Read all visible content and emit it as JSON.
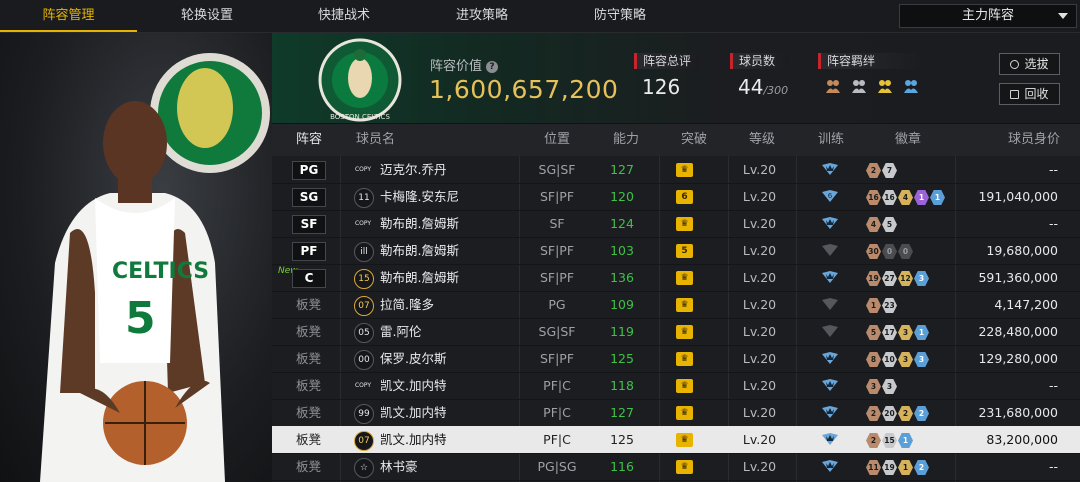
{
  "nav": {
    "tabs": [
      {
        "label": "阵容管理",
        "active": true
      },
      {
        "label": "轮换设置",
        "active": false
      },
      {
        "label": "快捷战术",
        "active": false
      },
      {
        "label": "进攻策略",
        "active": false
      },
      {
        "label": "防守策略",
        "active": false
      }
    ],
    "lineup_select": "主力阵容"
  },
  "header": {
    "team_logo_text": "BOSTON CELTICS",
    "value_label": "阵容价值",
    "value": "1,600,657,200",
    "overall_label": "阵容总评",
    "overall": "126",
    "players_label": "球员数",
    "players": "44",
    "players_max": "/300",
    "chem_label": "阵容羁绊",
    "draft_btn": "选拔",
    "recycle_btn": "回收"
  },
  "columns": {
    "lineup": "阵容",
    "name": "球员名",
    "position": "位置",
    "ability": "能力",
    "breakthrough": "突破",
    "level": "等级",
    "training": "训练",
    "badges": "徽章",
    "salary": "球员身价"
  },
  "colors": {
    "accent": "#e6b400",
    "ability_green": "#3fc047",
    "selected_row": "#e9e9e9"
  },
  "rows": [
    {
      "slot": "PG",
      "new": "",
      "jersey": "COPY",
      "name": "迈克尔.乔丹",
      "pos": "SG|SF",
      "ovr": "127",
      "brk": "♛",
      "lv": "Lv.20",
      "train": "on",
      "badges": [
        [
          "bronze",
          "2"
        ],
        [
          "silver",
          "7"
        ]
      ],
      "salary": "--"
    },
    {
      "slot": "SG",
      "new": "",
      "jersey": "11",
      "name": "卡梅隆.安东尼",
      "pos": "SF|PF",
      "ovr": "120",
      "brk": "6",
      "lv": "Lv.20",
      "train": "6",
      "badges": [
        [
          "bronze",
          "16"
        ],
        [
          "silver",
          "16"
        ],
        [
          "gold",
          "4"
        ],
        [
          "purple",
          "1"
        ],
        [
          "blue",
          "1"
        ]
      ],
      "salary": "191,040,000"
    },
    {
      "slot": "SF",
      "new": "",
      "jersey": "COPY",
      "name": "勒布朗.詹姆斯",
      "pos": "SF",
      "ovr": "124",
      "brk": "♛",
      "lv": "Lv.20",
      "train": "on",
      "badges": [
        [
          "bronze",
          "4"
        ],
        [
          "silver",
          "5"
        ]
      ],
      "salary": "--"
    },
    {
      "slot": "PF",
      "new": "",
      "jersey": "ill",
      "name": "勒布朗.詹姆斯",
      "pos": "SF|PF",
      "ovr": "103",
      "brk": "5",
      "lv": "Lv.20",
      "train": "off",
      "badges": [
        [
          "bronze",
          "30"
        ],
        [
          "dark",
          "0"
        ],
        [
          "dark",
          "0"
        ]
      ],
      "salary": "19,680,000"
    },
    {
      "slot": "C",
      "new": "New",
      "jersey": "15",
      "name": "勒布朗.詹姆斯",
      "pos": "SF|PF",
      "ovr": "136",
      "brk": "♛",
      "lv": "Lv.20",
      "train": "on",
      "badges": [
        [
          "bronze",
          "19"
        ],
        [
          "silver",
          "27"
        ],
        [
          "gold",
          "12"
        ],
        [
          "blue",
          "3"
        ]
      ],
      "salary": "591,360,000"
    },
    {
      "slot": "板凳",
      "new": "",
      "jersey": "07",
      "name": "拉简.隆多",
      "pos": "PG",
      "ovr": "109",
      "brk": "♛",
      "lv": "Lv.20",
      "train": "off",
      "badges": [
        [
          "bronze",
          "1"
        ],
        [
          "silver",
          "23"
        ]
      ],
      "salary": "4,147,200"
    },
    {
      "slot": "板凳",
      "new": "",
      "jersey": "05",
      "name": "雷.阿伦",
      "pos": "SG|SF",
      "ovr": "119",
      "brk": "♛",
      "lv": "Lv.20",
      "train": "off",
      "badges": [
        [
          "bronze",
          "5"
        ],
        [
          "silver",
          "17"
        ],
        [
          "gold",
          "3"
        ],
        [
          "blue",
          "1"
        ]
      ],
      "salary": "228,480,000"
    },
    {
      "slot": "板凳",
      "new": "",
      "jersey": "00",
      "name": "保罗.皮尔斯",
      "pos": "SF|PF",
      "ovr": "125",
      "brk": "♛",
      "lv": "Lv.20",
      "train": "on",
      "badges": [
        [
          "bronze",
          "8"
        ],
        [
          "silver",
          "10"
        ],
        [
          "gold",
          "3"
        ],
        [
          "blue",
          "3"
        ]
      ],
      "salary": "129,280,000"
    },
    {
      "slot": "板凳",
      "new": "",
      "jersey": "COPY",
      "name": "凯文.加内特",
      "pos": "PF|C",
      "ovr": "118",
      "brk": "♛",
      "lv": "Lv.20",
      "train": "on",
      "badges": [
        [
          "bronze",
          "3"
        ],
        [
          "silver",
          "3"
        ]
      ],
      "salary": "--"
    },
    {
      "slot": "板凳",
      "new": "",
      "jersey": "99",
      "name": "凯文.加内特",
      "pos": "PF|C",
      "ovr": "127",
      "brk": "♛",
      "lv": "Lv.20",
      "train": "on",
      "badges": [
        [
          "bronze",
          "2"
        ],
        [
          "silver",
          "20"
        ],
        [
          "gold",
          "2"
        ],
        [
          "blue",
          "2"
        ]
      ],
      "salary": "231,680,000"
    },
    {
      "slot": "板凳",
      "new": "",
      "jersey": "07",
      "name": "凯文.加内特",
      "pos": "PF|C",
      "ovr": "125",
      "brk": "♛",
      "lv": "Lv.20",
      "train": "on",
      "badges": [
        [
          "bronze",
          "2"
        ],
        [
          "silver",
          "15"
        ],
        [
          "blue",
          "1"
        ]
      ],
      "salary": "83,200,000",
      "selected": true
    },
    {
      "slot": "板凳",
      "new": "",
      "jersey": "☆",
      "name": "林书豪",
      "pos": "PG|SG",
      "ovr": "116",
      "brk": "♛",
      "lv": "Lv.20",
      "train": "on",
      "badges": [
        [
          "bronze",
          "11"
        ],
        [
          "silver",
          "19"
        ],
        [
          "gold",
          "1"
        ],
        [
          "blue",
          "2"
        ]
      ],
      "salary": "--"
    }
  ]
}
